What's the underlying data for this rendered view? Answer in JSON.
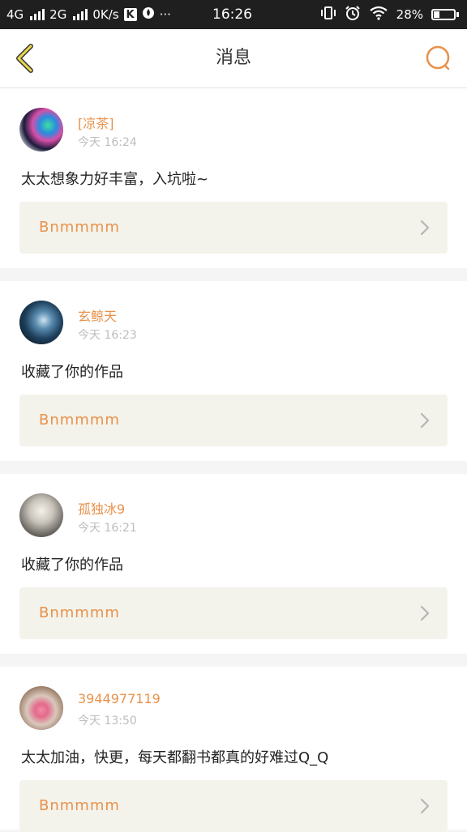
{
  "status_bar": {
    "net1": "4G",
    "net2": "2G",
    "speed": "0K/s",
    "k_badge": "K",
    "more": "···",
    "time": "16:26",
    "battery_pct": "28%",
    "battery_level": 0.28,
    "icons": [
      "signal-icon",
      "signal-icon",
      "k-app-icon",
      "app-notification-icon",
      "vibrate-icon",
      "alarm-icon",
      "wifi-icon",
      "battery-icon"
    ]
  },
  "header": {
    "title": "消息",
    "back_icon": "chevron-left-icon",
    "search_icon": "search-icon"
  },
  "colors": {
    "accent": "#e8914a",
    "back_yellow": "#e8d84a",
    "quote_bg": "#f3f3ec"
  },
  "messages": [
    {
      "name": "[凉茶]",
      "time": "今天 16:24",
      "text": "太太想象力好丰富，入坑啦~",
      "quote": "Bnmmmm"
    },
    {
      "name": "玄鲸天",
      "time": "今天 16:23",
      "text": "收藏了你的作品",
      "quote": "Bnmmmm"
    },
    {
      "name": "孤独冰9",
      "time": "今天 16:21",
      "text": "收藏了你的作品",
      "quote": "Bnmmmm"
    },
    {
      "name": "3944977119",
      "time": "今天 13:50",
      "text": "太太加油，快更，每天都翻书都真的好难过Q_Q",
      "quote": "Bnmmmm"
    }
  ]
}
